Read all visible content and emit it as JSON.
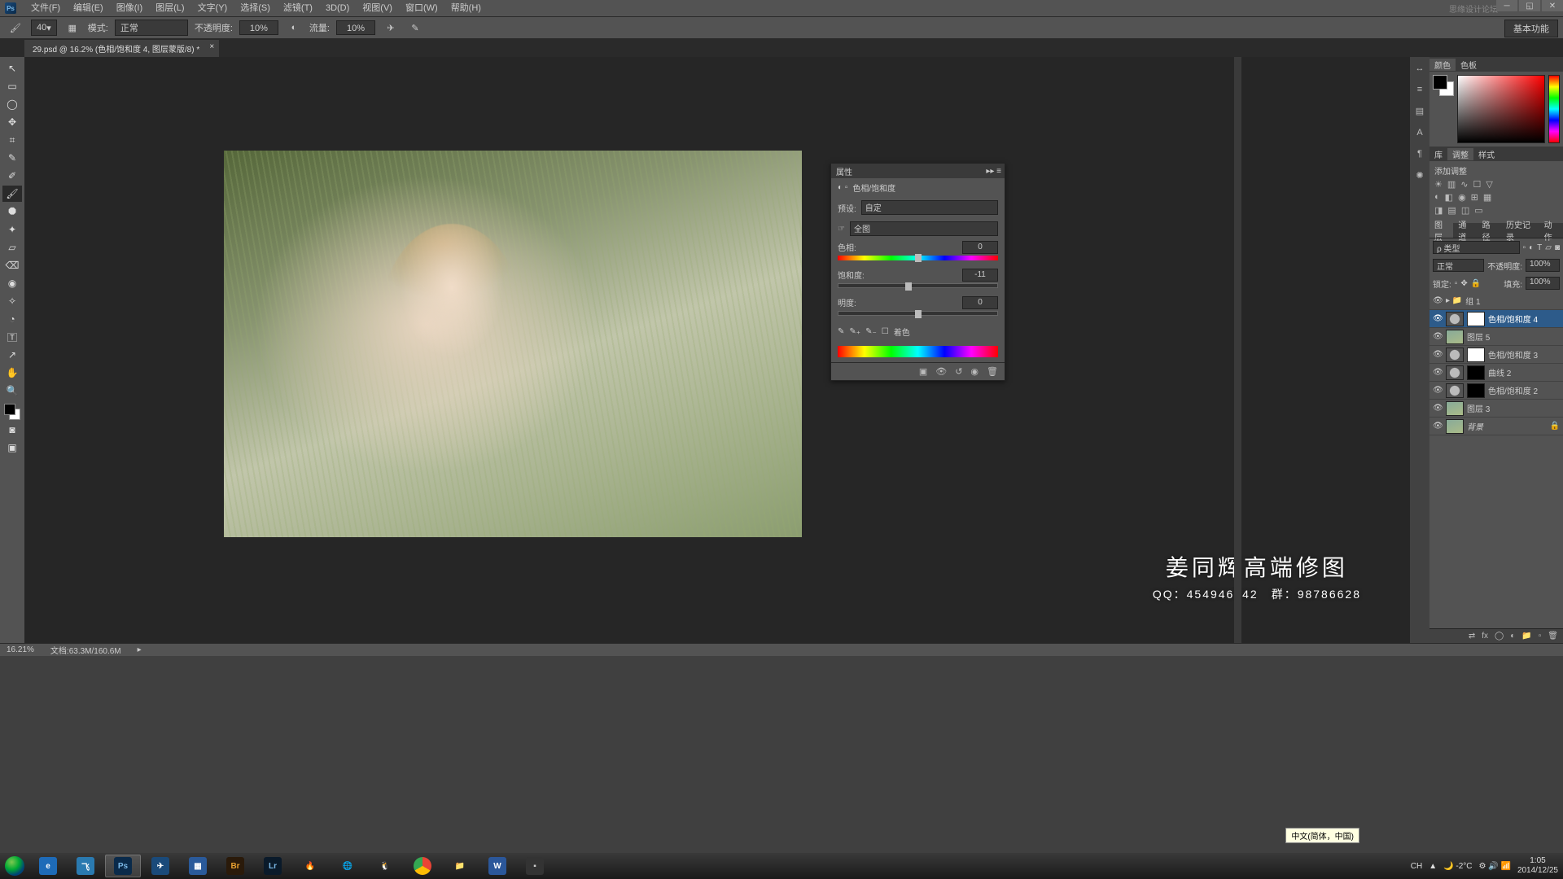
{
  "menu": {
    "items": [
      "文件(F)",
      "编辑(E)",
      "图像(I)",
      "图层(L)",
      "文字(Y)",
      "选择(S)",
      "滤镜(T)",
      "3D(D)",
      "视图(V)",
      "窗口(W)",
      "帮助(H)"
    ],
    "brand": "思缘设计论坛"
  },
  "optbar": {
    "mode_label": "模式:",
    "mode_value": "正常",
    "opacity_label": "不透明度:",
    "opacity_value": "10%",
    "flow_label": "流量:",
    "flow_value": "10%",
    "brush_size": "40",
    "workspace": "基本功能"
  },
  "doctab": {
    "title": "29.psd @ 16.2% (色相/饱和度 4, 图层蒙版/8) *"
  },
  "tools": [
    "↖",
    "▭",
    "◯",
    "✥",
    "⌗",
    "✎",
    "✐",
    "🖌",
    "⯃",
    "✦",
    "▱",
    "⌫",
    "◉",
    "✧",
    "◔",
    "✎",
    "🅃",
    "↗",
    "✋",
    "🔍"
  ],
  "watermark": {
    "l1": "姜同辉高端修图",
    "l2_left": "QQ：454946742",
    "l2_right": "群：98786628"
  },
  "prop": {
    "title": "属性",
    "subtitle": "色相/饱和度",
    "preset_label": "预设:",
    "preset_value": "自定",
    "channel_value": "全图",
    "hue_label": "色相:",
    "hue_value": "0",
    "sat_label": "饱和度:",
    "sat_value": "-11",
    "light_label": "明度:",
    "light_value": "0",
    "colorize": "着色"
  },
  "right": {
    "color_tab1": "颜色",
    "color_tab2": "色板",
    "adj_tab1": "库",
    "adj_tab2": "调整",
    "adj_tab3": "样式",
    "adj_title": "添加调整",
    "layers_tab1": "图层",
    "layers_tab2": "通道",
    "layers_tab3": "路径",
    "layers_tab4": "历史记录",
    "layers_tab5": "动作",
    "blend_kind": "ρ 类型",
    "blend_mode": "正常",
    "opacity_label": "不透明度:",
    "opacity_value": "100%",
    "lock_label": "锁定:",
    "fill_label": "填充:",
    "fill_value": "100%",
    "layers": [
      {
        "name": "组 1",
        "kind": "group"
      },
      {
        "name": "色相/饱和度 4",
        "kind": "adj",
        "selected": true
      },
      {
        "name": "图层 5",
        "kind": "img"
      },
      {
        "name": "色相/饱和度 3",
        "kind": "adj"
      },
      {
        "name": "曲线 2",
        "kind": "adj",
        "dark": true
      },
      {
        "name": "色相/饱和度 2",
        "kind": "adj",
        "dark": true
      },
      {
        "name": "图层 3",
        "kind": "img",
        "nomark": true
      },
      {
        "name": "背景",
        "kind": "img",
        "locked": true
      }
    ]
  },
  "status": {
    "zoom": "16.21%",
    "doc": "文档:63.3M/160.6M"
  },
  "ime": "中文(简体，中国)",
  "tray": {
    "temp": "-2°C",
    "time": "1:05",
    "date": "2014/12/25"
  },
  "taskbar_apps": [
    "IE",
    "飞",
    "Ps",
    "✈",
    "☰",
    "Br",
    "Lr",
    "🔥",
    "Q",
    "🐧",
    "◯",
    "📁",
    "W",
    "■"
  ]
}
